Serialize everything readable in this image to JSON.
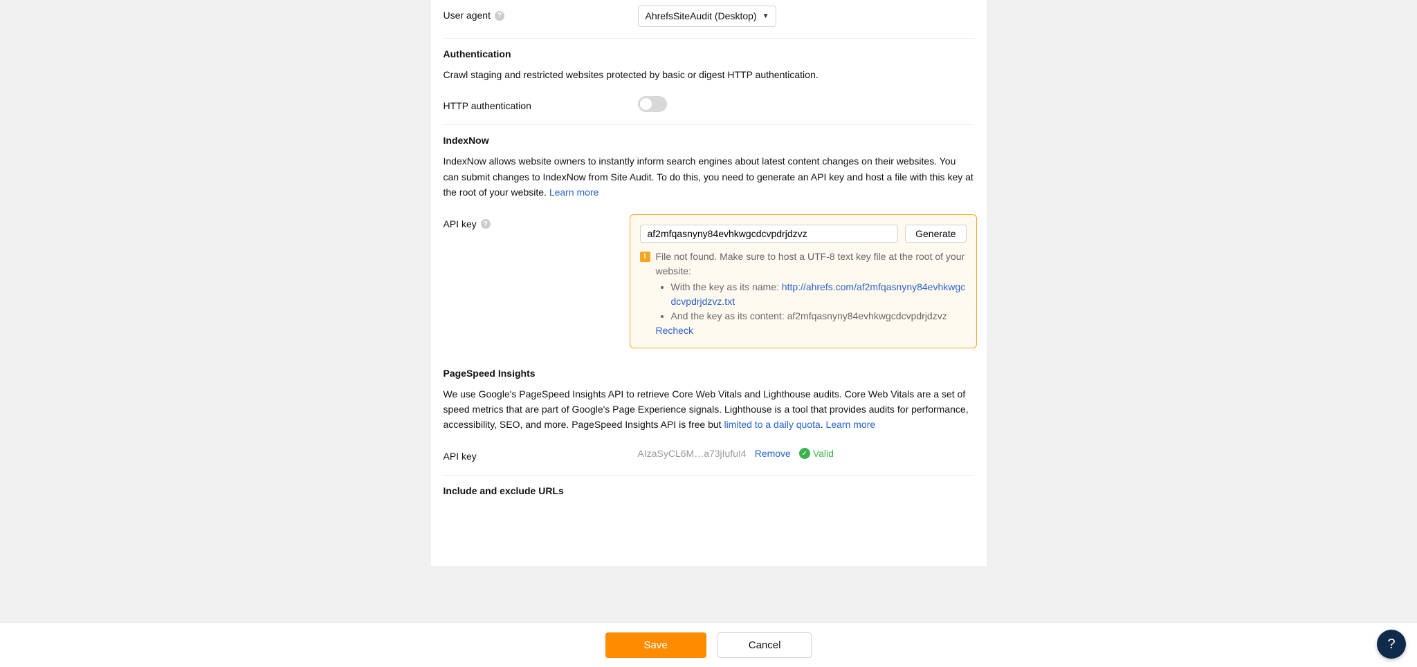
{
  "useragent": {
    "label": "User agent",
    "selected": "AhrefsSiteAudit (Desktop)"
  },
  "auth": {
    "title": "Authentication",
    "desc": "Crawl staging and restricted websites protected by basic or digest HTTP authentication.",
    "toggle_label": "HTTP authentication",
    "enabled": false
  },
  "indexnow": {
    "title": "IndexNow",
    "desc": "IndexNow allows website owners to instantly inform search engines about latest content changes on their websites. You can submit changes to IndexNow from Site Audit. To do this, you need to generate an API key and host a file with this key at the root of your website. ",
    "learn_more": "Learn more",
    "apikey_label": "API key",
    "apikey_value": "af2mfqasnyny84evhkwgcdcvpdrjdzvz",
    "generate": "Generate",
    "warn_intro": "File not found. Make sure to host a UTF-8 text key file at the root of your website:",
    "warn_li1": "With the key as its name: ",
    "warn_link": "http://ahrefs.com/af2mfqasnyny84evhkwgcdcvpdrjdzvz.txt",
    "warn_li2": "And the key as its content: af2mfqasnyny84evhkwgcdcvpdrjdzvz",
    "recheck": "Recheck"
  },
  "psi": {
    "title": "PageSpeed Insights",
    "desc": "We use Google's PageSpeed Insights API to retrieve Core Web Vitals and Lighthouse audits. Core Web Vitals are a set of speed metrics that are part of Google's Page Experience signals. Lighthouse is a tool that provides audits for performance, accessibility, SEO, and more. PageSpeed Insights API is free but ",
    "quota_link": "limited to a daily quota",
    "period": ". ",
    "learn_more": "Learn more",
    "apikey_label": "API key",
    "apikey_value": "AIzaSyCL6M…a73jIufuI4",
    "remove": "Remove",
    "valid": "Valid"
  },
  "include_exclude": {
    "title": "Include and exclude URLs"
  },
  "footer": {
    "save": "Save",
    "cancel": "Cancel"
  }
}
